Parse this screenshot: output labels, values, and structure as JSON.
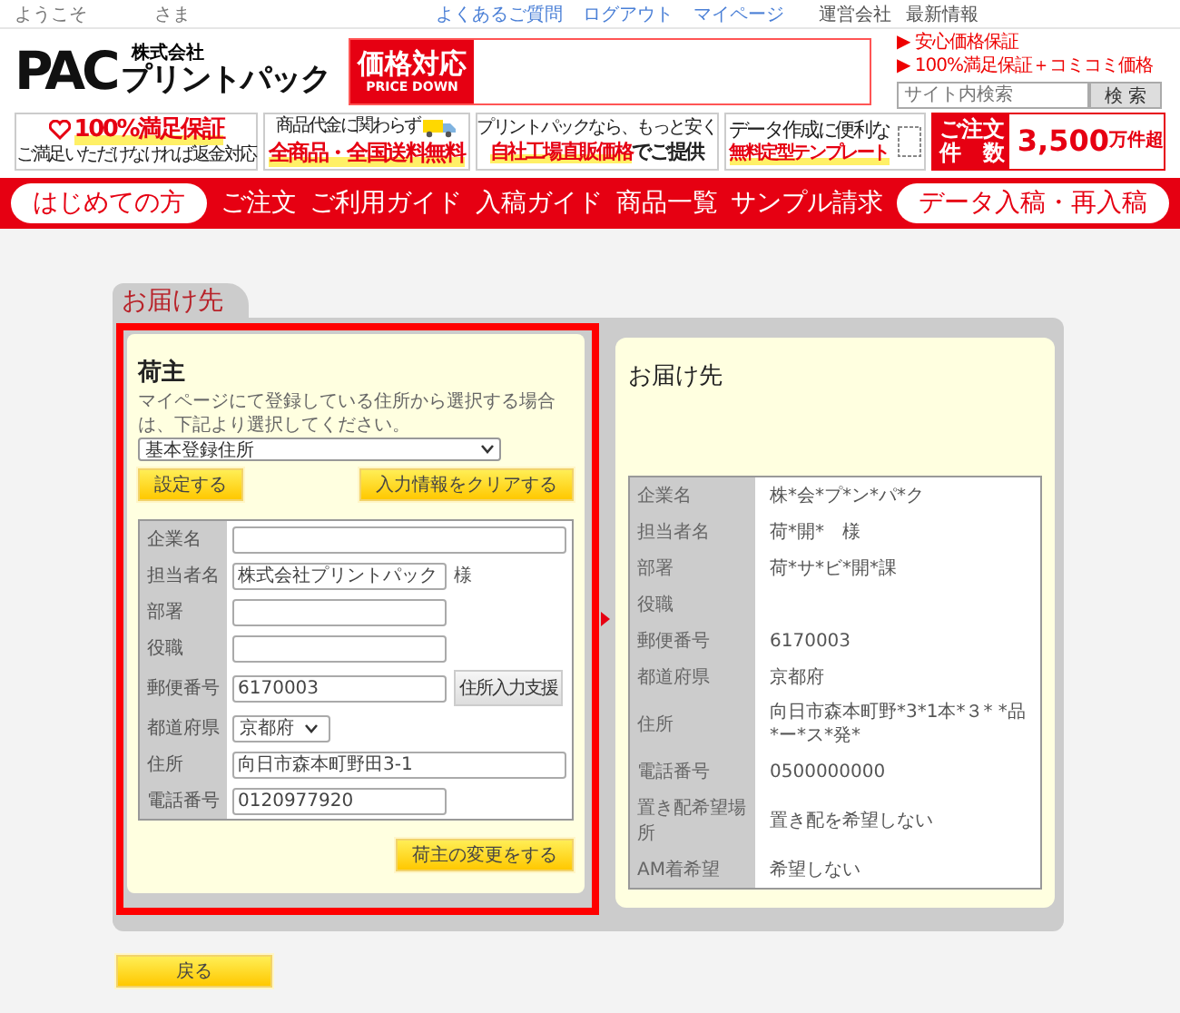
{
  "top_bar": {
    "greeting": "ようこそ",
    "honorific": "さま",
    "user_links": [
      "よくあるご質問",
      "ログアウト",
      "マイページ"
    ],
    "info_links": [
      "運営会社",
      "最新情報"
    ]
  },
  "header": {
    "logo": {
      "mark": "PAC",
      "company_type": "株式会社",
      "name": "プリントパック"
    },
    "price_banner": {
      "title": "価格対応",
      "subtitle": "PRICE DOWN"
    },
    "guarantee_links": [
      "▶ 安心価格保証",
      "▶ 100%満足保証＋コミコミ価格"
    ],
    "search": {
      "placeholder": "サイト内検索",
      "button": "検 索"
    }
  },
  "promo_banners": [
    {
      "kind": "guarantee",
      "headline": "100%満足保証",
      "caption": "ご満足いただけなければ返金対応"
    },
    {
      "kind": "shipping",
      "caption": "商品代金に関わらず",
      "headline": "全商品・全国送料無料"
    },
    {
      "kind": "factory",
      "caption": "プリントパックなら、もっと安く",
      "headline": "**自社工場直販価格**でご提供"
    },
    {
      "kind": "template",
      "caption": "データ作成に便利な",
      "headline": "無料定型テンプレート"
    },
    {
      "kind": "orders",
      "label": "ご注文件　数",
      "count": "3,500",
      "unit": "万件超"
    }
  ],
  "nav": [
    {
      "label": "はじめての方",
      "kind": "pill"
    },
    {
      "label": "ご注文",
      "kind": "plain"
    },
    {
      "label": "ご利用ガイド",
      "kind": "plain"
    },
    {
      "label": "入稿ガイド",
      "kind": "plain"
    },
    {
      "label": "商品一覧",
      "kind": "plain"
    },
    {
      "label": "サンプル請求",
      "kind": "plain"
    },
    {
      "label": "データ入稿・再入稿",
      "kind": "pill"
    }
  ],
  "tab": "お届け先",
  "shipper": {
    "heading": "荷主",
    "note": "マイページにて登録している住所から選択する場合は、下記より選択してください。",
    "address_select": "基本登録住所",
    "set_button": "設定する",
    "clear_button": "入力情報をクリアする",
    "fields": [
      {
        "label": "企業名",
        "kind": "wide"
      },
      {
        "label": "担当者名",
        "kind": "narrow",
        "value": "株式会社プリントパック",
        "suffix": "様"
      },
      {
        "label": "部署",
        "kind": "narrow"
      },
      {
        "label": "役職",
        "kind": "narrow"
      },
      {
        "label": "郵便番号",
        "kind": "narrow",
        "value": "6170003",
        "action": "住所入力支援"
      },
      {
        "label": "都道府県",
        "kind": "select",
        "value": "京都府"
      },
      {
        "label": "住所",
        "kind": "wide",
        "value": "向日市森本町野田3-1"
      },
      {
        "label": "電話番号",
        "kind": "narrow",
        "value": "0120977920"
      }
    ],
    "change_button": "荷主の変更をする"
  },
  "delivery": {
    "heading": "お届け先",
    "rows": [
      {
        "label": "企業名",
        "value": "株*会*プ*ン*パ*ク"
      },
      {
        "label": "担当者名",
        "value": "荷*開*　様"
      },
      {
        "label": "部署",
        "value": "荷*サ*ビ*開*課"
      },
      {
        "label": "役職"
      },
      {
        "label": "郵便番号",
        "value": "6170003"
      },
      {
        "label": "都道府県",
        "value": "京都府"
      },
      {
        "label": "住所",
        "value": "向日市森本町野*3*1本*３* *品*ー*ス*発*"
      },
      {
        "label": "電話番号",
        "value": "0500000000"
      },
      {
        "label": "置き配希望場所",
        "value": "置き配を希望しない"
      },
      {
        "label": "AM着希望",
        "value": "希望しない"
      }
    ]
  },
  "back_button": "戻る"
}
